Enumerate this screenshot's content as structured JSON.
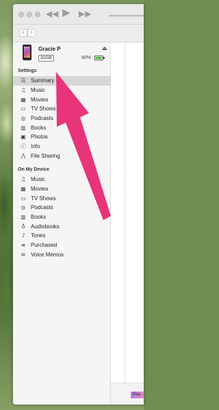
{
  "toolbar": {
    "rewind_icon": "rewind-icon",
    "play_icon": "play-icon",
    "fast_forward_icon": "fast-forward-icon"
  },
  "nav": {
    "back_glyph": "‹",
    "forward_glyph": "›"
  },
  "device": {
    "name": "Gracie P",
    "capacity": "32GB",
    "battery_percent": "80%",
    "battery_level": 0.8,
    "battery_color": "#3bbf2f"
  },
  "settings": {
    "heading": "Settings",
    "items": [
      {
        "label": "Summary",
        "icon": "summary-icon",
        "glyph": "☰",
        "selected": true
      },
      {
        "label": "Music",
        "icon": "music-icon",
        "glyph": "♫"
      },
      {
        "label": "Movies",
        "icon": "movies-icon",
        "glyph": "▦"
      },
      {
        "label": "TV Shows",
        "icon": "tv-icon",
        "glyph": "▭"
      },
      {
        "label": "Podcasts",
        "icon": "podcasts-icon",
        "glyph": "◎"
      },
      {
        "label": "Books",
        "icon": "books-icon",
        "glyph": "▥"
      },
      {
        "label": "Photos",
        "icon": "photos-icon",
        "glyph": "▣"
      },
      {
        "label": "Info",
        "icon": "info-icon",
        "glyph": "ⓘ"
      },
      {
        "label": "File Sharing",
        "icon": "file-sharing-icon",
        "glyph": "⋀"
      }
    ]
  },
  "on_device": {
    "heading": "On My Device",
    "items": [
      {
        "label": "Music",
        "icon": "music-icon",
        "glyph": "♫"
      },
      {
        "label": "Movies",
        "icon": "movies-icon",
        "glyph": "▦"
      },
      {
        "label": "TV Shows",
        "icon": "tv-icon",
        "glyph": "▭"
      },
      {
        "label": "Podcasts",
        "icon": "podcasts-icon",
        "glyph": "◎"
      },
      {
        "label": "Books",
        "icon": "books-icon",
        "glyph": "▥"
      },
      {
        "label": "Audiobooks",
        "icon": "audiobooks-icon",
        "glyph": "♁"
      },
      {
        "label": "Tones",
        "icon": "tones-icon",
        "glyph": "♪"
      },
      {
        "label": "Purchased",
        "icon": "purchased-icon",
        "glyph": "≡"
      },
      {
        "label": "Voice Memos",
        "icon": "voice-memos-icon",
        "glyph": "≋"
      }
    ]
  },
  "footer": {
    "photos_chip": "Pho"
  },
  "annotation": {
    "arrow_color": "#e8357a",
    "arrow_target": "Summary"
  }
}
